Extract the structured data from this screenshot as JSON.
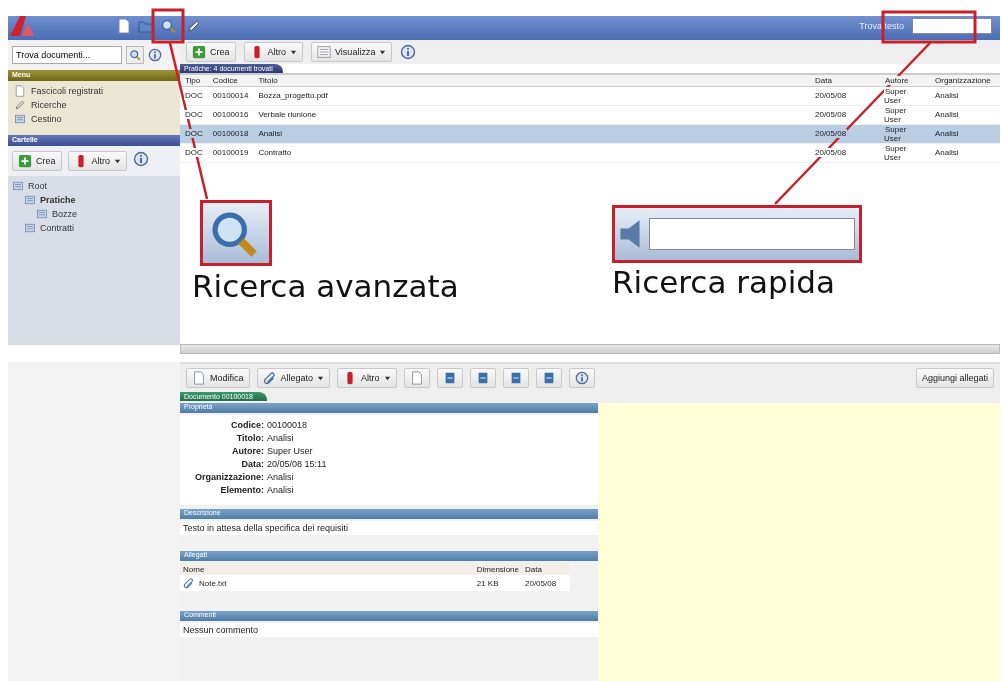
{
  "sidebar": {
    "search": {
      "value": "Trova documenti..."
    },
    "menu": {
      "title": "Menu",
      "items": [
        {
          "label": "Fascicoli registrati"
        },
        {
          "label": "Ricerche"
        },
        {
          "label": "Cestino"
        }
      ]
    },
    "folders": {
      "title": "Cartelle",
      "toolbar": [
        {
          "label": "Crea",
          "kind": "button"
        },
        {
          "label": "Altro",
          "kind": "dropdown"
        }
      ],
      "tree": [
        {
          "label": "Root",
          "selected": false,
          "children": [
            {
              "label": "Pratiche",
              "selected": true,
              "children": [
                {
                  "label": "Bozze",
                  "selected": false
                }
              ]
            },
            {
              "label": "Contratti",
              "selected": false
            }
          ]
        }
      ]
    }
  },
  "header": {
    "search_label": "Trova testo"
  },
  "toolbar": [
    {
      "label": "Crea",
      "kind": "button"
    },
    {
      "label": "Altro",
      "kind": "dropdown"
    },
    {
      "label": "Visualizza",
      "kind": "dropdown"
    }
  ],
  "list": {
    "tab": "Pratiche: 4 documenti trovati",
    "columns": [
      "Tipo",
      "Codice",
      "Titolo",
      "Data",
      "Autore",
      "Organizzazione"
    ],
    "rows": [
      {
        "cells": [
          "DOC",
          "00100014",
          "Bozza_progetto.pdf",
          "20/05/08",
          "Super User",
          "Analisi"
        ],
        "selected": false
      },
      {
        "cells": [
          "DOC",
          "00100016",
          "Verbale riunione",
          "20/05/08",
          "Super User",
          "Analisi"
        ],
        "selected": false
      },
      {
        "cells": [
          "DOC",
          "00100018",
          "Analisi",
          "20/05/08",
          "Super User",
          "Analisi"
        ],
        "selected": true
      },
      {
        "cells": [
          "DOC",
          "00100019",
          "Contratto",
          "20/05/08",
          "Super User",
          "Analisi"
        ],
        "selected": false
      }
    ]
  },
  "callouts": [
    {
      "kind": "icon",
      "label": "Ricerca avanzata"
    },
    {
      "kind": "field",
      "label": "Ricerca rapida"
    }
  ],
  "detail": {
    "toolbar": [
      {
        "label": "Modifica",
        "kind": "button"
      },
      {
        "label": "Allegato",
        "kind": "dropdown"
      },
      {
        "label": "Altro",
        "kind": "dropdown"
      }
    ],
    "add_button": "Aggiungi allegati",
    "tab": "Documento 00100018",
    "properties": {
      "title": "Proprietà",
      "fields": [
        {
          "label": "Codice:",
          "value": "00100018"
        },
        {
          "label": "Titolo:",
          "value": "Analisi"
        },
        {
          "label": "Autore:",
          "value": "Super User"
        },
        {
          "label": "Data:",
          "value": "20/05/08 15:11"
        },
        {
          "label": "Organizzazione:",
          "value": "Analisi"
        },
        {
          "label": "Elemento:",
          "value": "Analisi"
        }
      ]
    },
    "description": {
      "title": "Descrizione",
      "text": "Testo in attesa della specifica dei requisiti"
    },
    "attachments": {
      "title": "Allegati",
      "columns": [
        "Nome",
        "Dimensione",
        "Data"
      ],
      "rows": [
        [
          "Note.txt",
          "21 KB",
          "20/05/08"
        ]
      ]
    },
    "comments": {
      "title": "Commenti",
      "text": "Nessun commento"
    }
  }
}
